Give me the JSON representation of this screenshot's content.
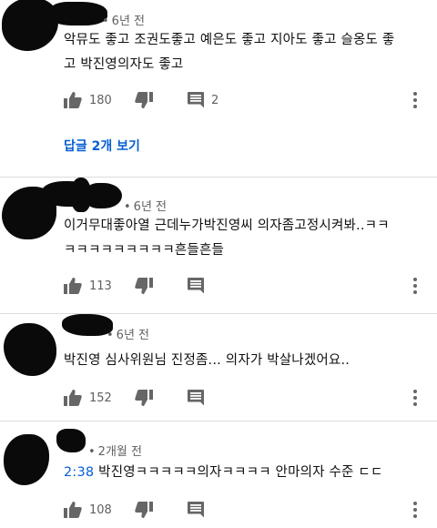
{
  "icons": {
    "like": "thumbs-up-icon",
    "dislike": "thumbs-down-icon",
    "reply": "comment-icon",
    "more": "more-vert-icon"
  },
  "colors": {
    "timestamp_link": "#065fd4",
    "reply_link": "#065fd4",
    "meta_text": "#606060"
  },
  "comments": [
    {
      "time": "6년 전",
      "text_lines": [
        "악뮤도 좋고 조권도좋고 예은도 좋고 지아도 좋고 슬옹도 좋",
        "고 박진영의자도 좋고"
      ],
      "likes": "180",
      "replies_count": "2",
      "view_replies": "답글 2개 보기"
    },
    {
      "time": "6년 전",
      "text_lines": [
        "이거무대좋아열 근데누가박진영씨 의자좀고정시켜봐..ㅋㅋ",
        "ㅋㅋㅋㅋㅋㅋㅋㅋㅋ흔들흔들"
      ],
      "likes": "113"
    },
    {
      "time": "6년 전",
      "text_lines": [
        "박진영 심사위원님 진정좀...  의자가 박살나겠어요.."
      ],
      "likes": "152"
    },
    {
      "time": "2개월 전",
      "timestamp": "2:38",
      "text_after_timestamp": " 박진영ㅋㅋㅋㅋㅋ의자ㅋㅋㅋㅋ 안마의자 수준 ㄷㄷ",
      "likes": "108"
    }
  ]
}
